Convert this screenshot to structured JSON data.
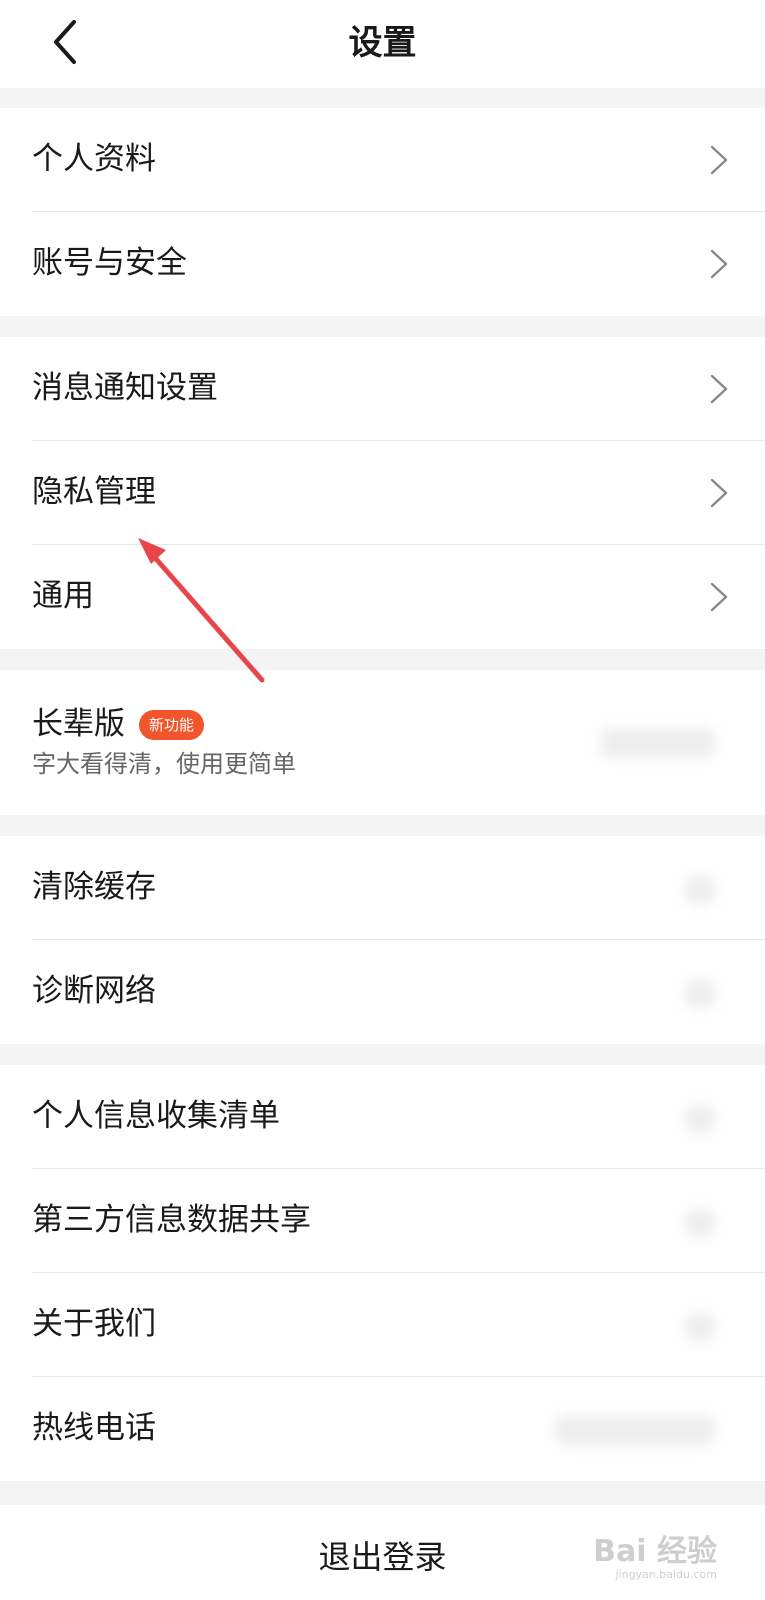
{
  "header": {
    "title": "设置"
  },
  "groups": {
    "g1": [
      "个人资料",
      "账号与安全"
    ],
    "g2": [
      "消息通知设置",
      "隐私管理",
      "通用"
    ],
    "elder": {
      "title": "长辈版",
      "badge": "新功能",
      "subtitle": "字大看得清，使用更简单"
    },
    "g4": [
      "清除缓存",
      "诊断网络"
    ],
    "g5": [
      "个人信息收集清单",
      "第三方信息数据共享",
      "关于我们",
      "热线电话"
    ]
  },
  "logout": {
    "label": "退出登录"
  },
  "watermark": {
    "text": "Bai 经验",
    "url": "jingyan.baidu.com"
  },
  "colors": {
    "badge": "#f2552c",
    "annotation_arrow": "#e8454a"
  }
}
